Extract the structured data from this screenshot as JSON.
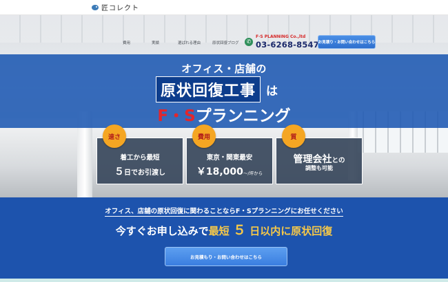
{
  "header": {
    "logo_text": "匠コレクト",
    "logo_icon": "bird-logo-icon"
  },
  "nav": {
    "items": [
      "費用",
      "実績",
      "選ばれる理由",
      "原状回復ブログ"
    ]
  },
  "contact": {
    "company": "F·S PLANNING Co.,ltd",
    "phone_icon": "phone-icon",
    "phone": "03-6268-8547",
    "cta_top": "お見積り・お問い合わせはこちら"
  },
  "headline": {
    "line1": "オフィス・店舗の",
    "line2_box": "原状回復工事",
    "line2_suffix": "は",
    "line3_red": "F・S",
    "line3_white": "プランニング"
  },
  "features": [
    {
      "badge": "速さ",
      "line1": "着工から最短",
      "line2_big": "５",
      "line2_rest": "日でお引渡し"
    },
    {
      "badge": "費用",
      "line1": "東京・関東最安",
      "line2_big": "￥18,000",
      "line2_rest": "〜/坪から"
    },
    {
      "badge": "質",
      "line1_big": "管理会社",
      "line1_rest": "との",
      "line2": "調整も可能"
    }
  ],
  "lower": {
    "line1_pre": "オフィス、店舗の",
    "line1_u": "原状回復",
    "line1_post": "に関わることなら",
    "line1_company": "F・Sプランニング",
    "line1_end": "にお任せください",
    "line2_pre": "今すぐお申し込みで",
    "line2_y1": "最短",
    "line2_num": "５",
    "line2_y2": "日以内に原状回復",
    "cta_bottom": "お見積もり・お問い合わせはこちら"
  },
  "colors": {
    "brand_blue": "#1d53ad",
    "accent_red": "#e2262c",
    "accent_yellow": "#f7c948",
    "badge_orange": "#f5a623"
  }
}
